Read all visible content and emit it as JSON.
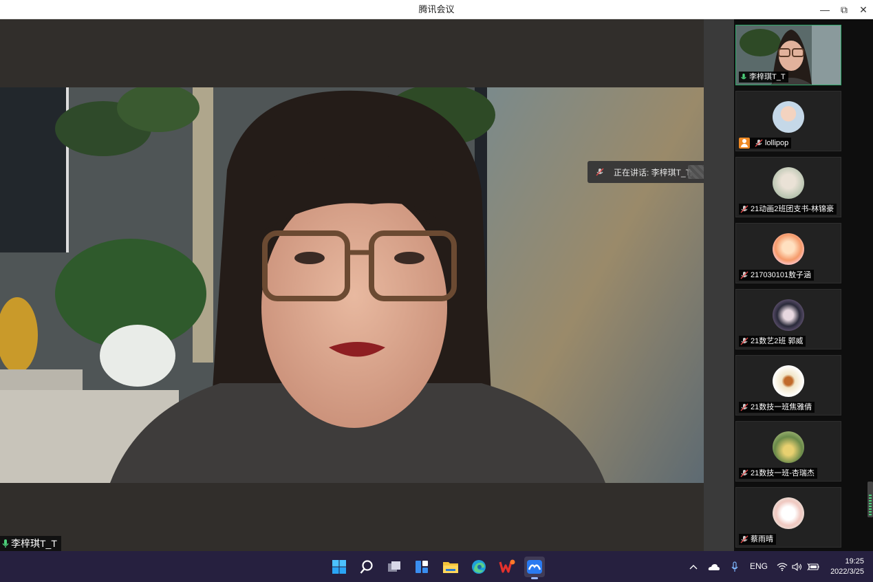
{
  "window": {
    "title": "腾讯会议",
    "minimize_icon": "—",
    "restore_icon": "⧉",
    "close_icon": "✕"
  },
  "main_video": {
    "speaker_name": "李梓琪T_T"
  },
  "toast": {
    "text": "正在讲话: 李梓琪T_T;"
  },
  "participants": [
    {
      "name": "李梓琪T_T",
      "mic": "on",
      "active": true
    },
    {
      "name": "lollipop",
      "mic": "off",
      "host": true
    },
    {
      "name": "21动画2班团支书-林锦豪",
      "mic": "off"
    },
    {
      "name": "217030101敖子涵",
      "mic": "off"
    },
    {
      "name": "21数艺2班 郭威",
      "mic": "off"
    },
    {
      "name": "21数技一班焦雅倩",
      "mic": "off"
    },
    {
      "name": "21数技一班-杏瑞杰",
      "mic": "off"
    },
    {
      "name": "蔡雨晴",
      "mic": "off"
    }
  ],
  "taskbar": {
    "apps": [
      "start-icon",
      "search-icon",
      "task-view-icon",
      "widgets-icon",
      "file-explorer-icon",
      "edge-icon",
      "wps-icon",
      "tencent-meeting-icon"
    ],
    "tray": {
      "language": "ENG",
      "time": "19:25",
      "date": "2022/3/25"
    }
  },
  "colors": {
    "active_border": "#2ea86a",
    "taskbar": "#26203f",
    "mic_on": "#4cd07a"
  }
}
